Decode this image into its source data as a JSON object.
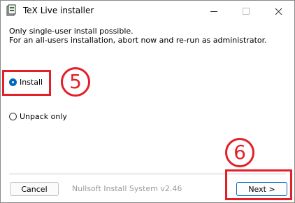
{
  "window": {
    "title": "TeX Live installer",
    "icon": "tex-live-installer-icon"
  },
  "message": {
    "line1": "Only single-user install possible.",
    "line2": "For an all-users installation, abort now and re-run as administrator."
  },
  "options": [
    {
      "label": "Install",
      "selected": true
    },
    {
      "label": "Unpack only",
      "selected": false
    }
  ],
  "annotations": {
    "step_install": "5",
    "step_next": "6",
    "highlight_color": "#e32028"
  },
  "footer": {
    "branding": "Nullsoft Install System v2.46",
    "cancel_label": "Cancel",
    "next_label": "Next >"
  },
  "colors": {
    "accent": "#0067c0"
  }
}
